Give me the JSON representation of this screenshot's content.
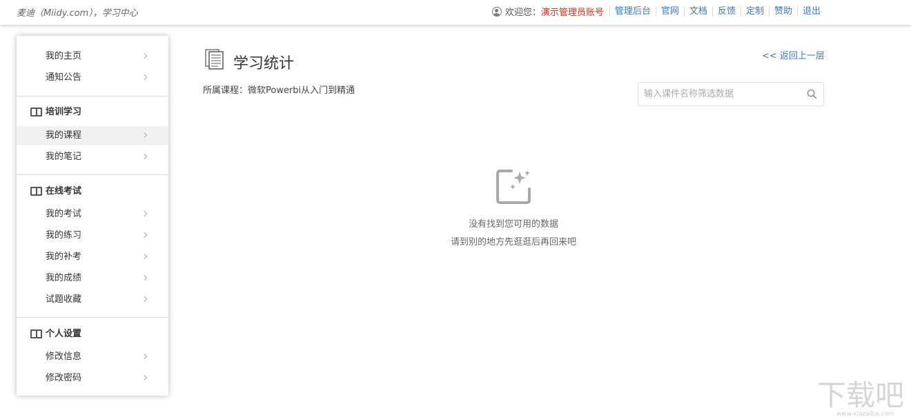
{
  "header": {
    "brand": "麦迪（Miidy.com），学习中心",
    "welcome": "欢迎您：",
    "account": "演示管理员账号",
    "links": [
      "管理后台",
      "官网",
      "文档",
      "反馈",
      "定制",
      "赞助",
      "退出"
    ]
  },
  "sidebar": {
    "top_items": [
      "我的主页",
      "通知公告"
    ],
    "sections": [
      {
        "title": "培训学习",
        "icon": "book-icon",
        "items": [
          "我的课程",
          "我的笔记"
        ]
      },
      {
        "title": "在线考试",
        "icon": "book-icon",
        "items": [
          "我的考试",
          "我的练习",
          "我的补考",
          "我的成绩",
          "试题收藏"
        ]
      },
      {
        "title": "个人设置",
        "icon": "book-icon",
        "items": [
          "修改信息",
          "修改密码"
        ]
      }
    ],
    "active_item": "我的课程"
  },
  "main": {
    "title": "学习统计",
    "back_link": "<< 返回上一层",
    "course_label": "所属课程：微软Powerbi从入门到精通",
    "search_placeholder": "输入课件名称筛选数据",
    "empty_line1": "没有找到您可用的数据",
    "empty_line2": "请到别的地方先逛逛后再回来吧"
  },
  "watermark": {
    "text": "下载吧",
    "url": "www.xiazaiba.com"
  },
  "colors": {
    "link": "#3a7bbf",
    "account": "#c0392b",
    "active_bg": "#f1f1f1"
  }
}
